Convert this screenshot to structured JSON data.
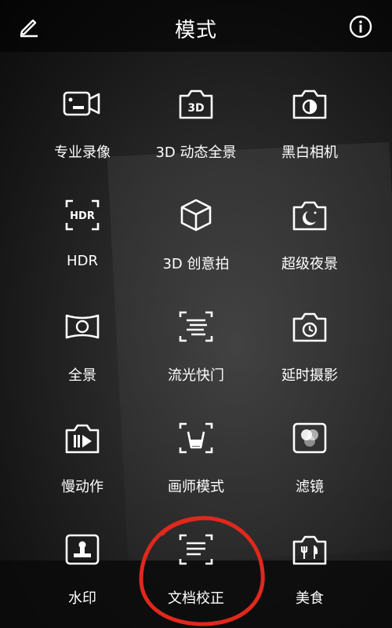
{
  "header": {
    "title": "模式"
  },
  "modes": [
    {
      "label": "专业录像",
      "icon": "video-camera-icon"
    },
    {
      "label": "3D 动态全景",
      "icon": "3d-camera-icon"
    },
    {
      "label": "黑白相机",
      "icon": "monochrome-camera-icon"
    },
    {
      "label": "HDR",
      "icon": "hdr-icon"
    },
    {
      "label": "3D 创意拍",
      "icon": "3d-cube-icon"
    },
    {
      "label": "超级夜景",
      "icon": "night-moon-icon"
    },
    {
      "label": "全景",
      "icon": "panorama-icon"
    },
    {
      "label": "流光快门",
      "icon": "light-trail-icon"
    },
    {
      "label": "延时摄影",
      "icon": "timelapse-icon"
    },
    {
      "label": "慢动作",
      "icon": "slow-motion-icon"
    },
    {
      "label": "画师模式",
      "icon": "painter-icon"
    },
    {
      "label": "滤镜",
      "icon": "filter-icon"
    },
    {
      "label": "水印",
      "icon": "watermark-stamp-icon"
    },
    {
      "label": "文档校正",
      "icon": "document-scan-icon"
    },
    {
      "label": "美食",
      "icon": "food-utensils-icon"
    }
  ],
  "colors": {
    "annotation": "#e0281c",
    "text": "#ffffff"
  }
}
